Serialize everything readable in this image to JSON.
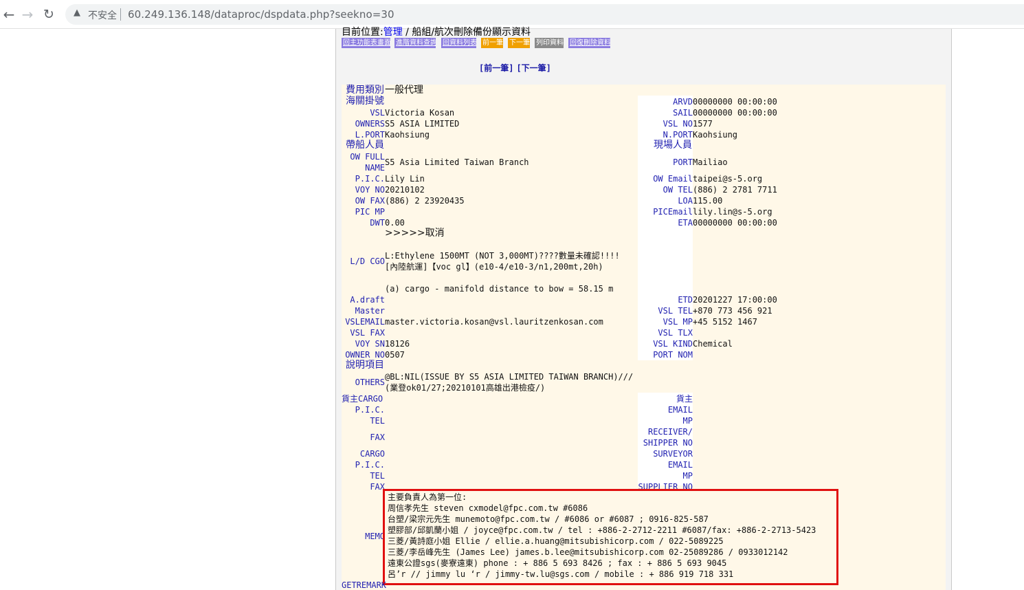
{
  "browser": {
    "insecure_label": "不安全",
    "url": "60.249.136.148/dataproc/dspdata.php?seekno=30",
    "back_glyph": "←",
    "forward_glyph": "→",
    "reload_glyph": "↻",
    "warning_glyph": "▲"
  },
  "location": {
    "prefix": "目前位置:",
    "link": "管理",
    "rest": " / 船組/航次刪除備份顯示資料"
  },
  "toolbar": {
    "main_menu": "回主功能表畫面",
    "advanced_query": "進階資料查詢",
    "back_to_list": "回資料列表",
    "prev": "前一筆",
    "next": "下一筆",
    "print": "列印資料",
    "restore": "回復刪除資料"
  },
  "pager": {
    "prev": "[前一筆]",
    "next": "[下一筆]"
  },
  "fields": {
    "fee_type_label": "費用類別",
    "fee_type_value": "一般代理",
    "customs_label": "海關掛號",
    "vsl_label": "VSL",
    "vsl_value": "Victoria Kosan",
    "owners_label": "OWNERS",
    "owners_value": "S5 ASIA LIMITED",
    "lport_label": "L.PORT",
    "lport_value": "Kaohsiung",
    "crew_label": "帶船人員",
    "ow_full_name_label_1": "OW FULL",
    "ow_full_name_label_2": "NAME",
    "ow_full_name_value": "S5 Asia Limited Taiwan Branch",
    "pic_label": "P.I.C.",
    "pic_value": "Lily Lin",
    "voy_no_label": "VOY NO",
    "voy_no_value": "20210102",
    "ow_fax_label": "OW FAX",
    "ow_fax_value": "(886) 2 23920435",
    "pic_mp_label": "PIC MP",
    "dwt_label": "DWT",
    "dwt_value": "0.00",
    "dwt_note": ">>>>>取消",
    "arvd_label": "ARVD",
    "arvd_value": "00000000 00:00:00",
    "sail_label": "SAIL",
    "sail_value": "00000000 00:00:00",
    "vsl_no_label": "VSL NO",
    "vsl_no_value": "1577",
    "nport_label": "N.PORT",
    "nport_value": "Kaohsiung",
    "onsite_label": "現場人員",
    "port_label": "PORT",
    "port_value": "Mailiao",
    "ow_email_label": "OW Email",
    "ow_email_value": "taipei@s-5.org",
    "ow_tel_label": "OW TEL",
    "ow_tel_value": "(886) 2 2781 7711",
    "loa_label": "LOA",
    "loa_value": "115.00",
    "pic_email_label": "PICEmail",
    "pic_email_value": "lily.lin@s-5.org",
    "eta_label": "ETA",
    "eta_value": "00000000 00:00:00",
    "ld_cgo_label": "L/D CGO",
    "ld_cgo_line1": "L:Ethylene 1500MT (NOT 3,000MT)????數量未確認!!!!",
    "ld_cgo_line2": "[內陸航運]【voc gl】(e10-4/e10-3/n1,200mt,20h)",
    "ld_cgo_line3": "(a) cargo - manifold distance to bow = 58.15 m",
    "adraft_label": "A.draft",
    "master_label": "Master",
    "vsl_email_label": "VSLEMAIL",
    "vsl_email_value": "master.victoria.kosan@vsl.lauritzenkosan.com",
    "vsl_fax_label": "VSL FAX",
    "voy_sn_label": "VOY SN",
    "voy_sn_value": "18126",
    "owner_no_label": "OWNER NO",
    "owner_no_value": "0507",
    "etd_label": "ETD",
    "etd_value": "20201227 17:00:00",
    "vsl_tel_label": "VSL TEL",
    "vsl_tel_value": "+870 773 456 921",
    "vsl_mp_label": "VSL MP",
    "vsl_mp_value": "+45 5152 1467",
    "vsl_tlx_label": "VSL TLX",
    "vsl_kind_label": "VSL KIND",
    "vsl_kind_value": "Chemical",
    "port_nom_label": "PORT NOM",
    "notes_label": "說明項目",
    "others_label": "OTHERS",
    "others_line1": "@BL:NIL(ISSUE BY S5 ASIA LIMITED TAIWAN BRANCH)///",
    "others_line2": "(業登ok01/27;20210101高雄出港檢疫/)",
    "cargo_owner_label": "貨主CARGO",
    "cargo_pic_label": "P.I.C.",
    "cargo_tel_label": "TEL",
    "cargo_fax_label": "FAX",
    "cargo_label": "CARGO",
    "cargo_pic2_label": "P.I.C.",
    "cargo_tel2_label": "TEL",
    "cargo_fax2_label": "FAX",
    "owner_label_r": "貨主",
    "email_label_r": "EMAIL",
    "mp_label_r": "MP",
    "receiver_label_r": "RECEIVER/",
    "shipper_no_label_r": "SHIPPER NO",
    "surveyor_label_r": "SURVEYOR",
    "email2_label_r": "EMAIL",
    "mp2_label_r": "MP",
    "supplier_no_label_r": "SUPPLIER NO",
    "memo_label": "MEMO",
    "getremark_label": "GETREMARK"
  },
  "memo_lines": [
    "主要負責人為第一位:",
    "周信孝先生 steven cxmodel@fpc.com.tw #6086",
    "台塑/梁宗元先生 munemoto@fpc.com.tw / #6086 or #6087 ; 0916-825-587",
    "塑膠部/邱凱蘭小姐 / joyce@fpc.com.tw / tel : +886-2-2712-2211 #6087/fax: +886-2-2713-5423",
    "三菱/黃詩庭小姐 Ellie / ellie.a.huang@mitsubishicorp.com / 022-5089225",
    "三菱/李岳峰先生 (James Lee) james.b.lee@mitsubishicorp.com 02-25089286 / 0933012142",
    "遠東公證sgs(麥寮遠東) phone : + 886 5 693 8426 ; fax : + 886 5 693 9045",
    "呂’r // jimmy lu ‘r / jimmy-tw.lu@sgs.com / mobile : + 886 919 718 331"
  ]
}
